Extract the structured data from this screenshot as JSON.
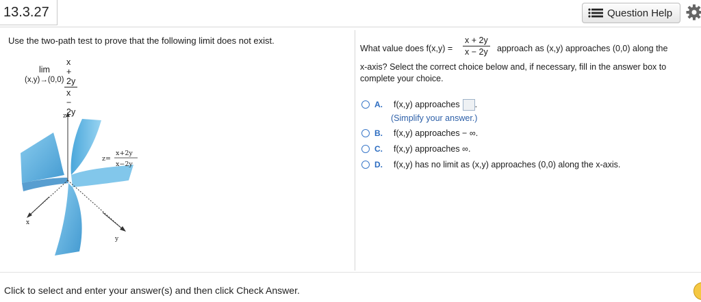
{
  "header": {
    "problem_number": "13.3.27",
    "question_help_label": "Question Help"
  },
  "left": {
    "instruction": "Use the two-path test to prove that the following limit does not exist.",
    "limit": {
      "lim_word": "lim",
      "subscript": "(x,y)→(0,0)",
      "numerator": "x + 2y",
      "denominator": "x − 2y"
    },
    "graph": {
      "z_label": "z",
      "x_label": "x",
      "y_label": "y",
      "eq_prefix": "z=",
      "eq_numerator": "x+2y",
      "eq_denominator": "x−2y"
    }
  },
  "right": {
    "question_prefix": "What value does f(x,y) =",
    "question_numerator": "x + 2y",
    "question_denominator": "x − 2y",
    "question_suffix": "approach as (x,y) approaches (0,0) along the",
    "question_line2": "x-axis? Select the correct choice below and, if necessary, fill in the answer box to",
    "question_line3": "complete your choice.",
    "choices": [
      {
        "letter": "A.",
        "text": "f(x,y) approaches",
        "after_box": "."
      },
      {
        "letter": "B.",
        "text": "f(x,y) approaches  − ∞."
      },
      {
        "letter": "C.",
        "text": "f(x,y) approaches ∞."
      },
      {
        "letter": "D.",
        "text": "f(x,y) has no limit as (x,y) approaches (0,0) along the x-axis."
      }
    ],
    "hint": "(Simplify your answer.)"
  },
  "footer": {
    "instruction": "Click to select and enter your answer(s) and then click Check Answer."
  },
  "icons": {
    "list": "list-icon",
    "settings": "gear-icon",
    "help": "help-circle-icon"
  },
  "colors": {
    "accent_blue": "#2c6cc0",
    "surface_blue": "#3fa3db",
    "help_yellow": "#f5c842"
  }
}
